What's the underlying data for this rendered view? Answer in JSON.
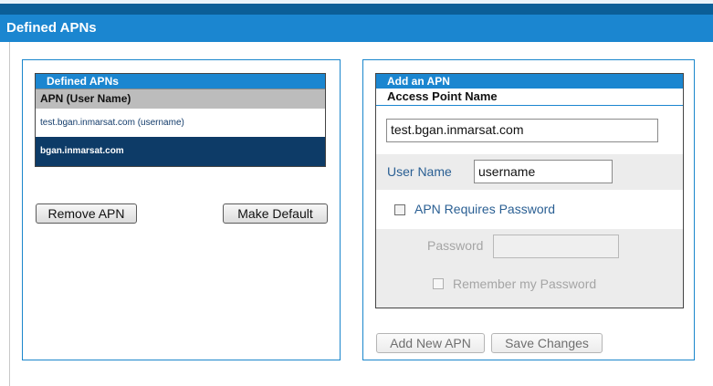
{
  "page": {
    "title": "Defined APNs"
  },
  "defined_apns": {
    "header": "Defined APNs",
    "column_header": "APN (User Name)",
    "rows": [
      {
        "text": "test.bgan.inmarsat.com (username)",
        "selected": false
      },
      {
        "text": "bgan.inmarsat.com",
        "selected": true
      }
    ],
    "buttons": {
      "remove": "Remove APN",
      "make_default": "Make Default"
    }
  },
  "add_apn": {
    "header": "Add an APN",
    "access_point_name_label": "Access Point Name",
    "access_point_name_value": "test.bgan.inmarsat.com",
    "username_label": "User Name",
    "username_value": "username",
    "requires_password_label": "APN Requires Password",
    "requires_password_checked": false,
    "password_label": "Password",
    "password_value": "",
    "remember_password_label": "Remember my Password",
    "remember_password_checked": false,
    "buttons": {
      "add_new": "Add New APN",
      "save": "Save Changes"
    }
  },
  "colors": {
    "accent": "#1b86d0",
    "dark_header": "#0b5e97",
    "selected_row": "#0d3b67",
    "column_header_bg": "#bcbcbc"
  }
}
